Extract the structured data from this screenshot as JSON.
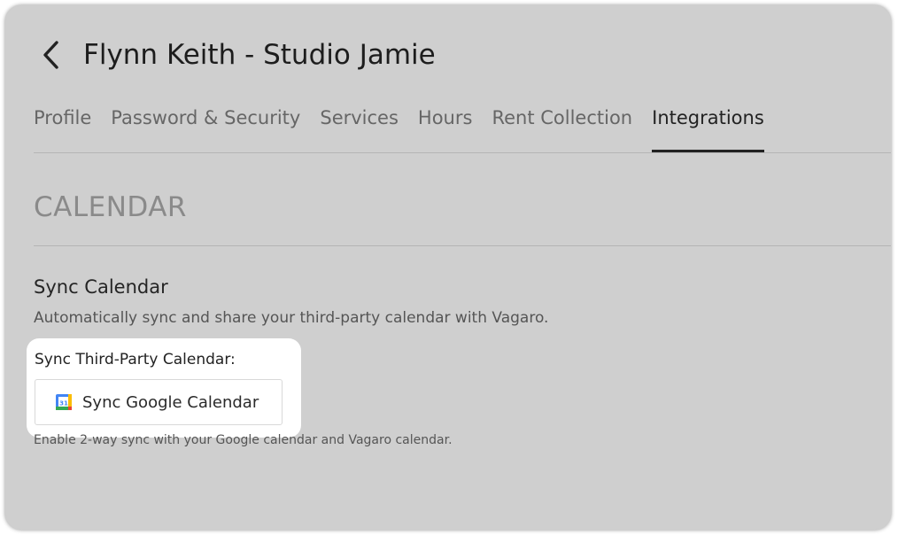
{
  "header": {
    "title": "Flynn Keith - Studio Jamie",
    "back_icon": "chevron-left-icon"
  },
  "tabs": [
    {
      "label": "Profile",
      "active": false
    },
    {
      "label": "Password & Security",
      "active": false
    },
    {
      "label": "Services",
      "active": false
    },
    {
      "label": "Hours",
      "active": false
    },
    {
      "label": "Rent Collection",
      "active": false
    },
    {
      "label": "Integrations",
      "active": true
    }
  ],
  "section": {
    "title": "CALENDAR"
  },
  "sync": {
    "heading": "Sync Calendar",
    "description": "Automatically sync and share your third-party calendar with Vagaro.",
    "third_party_label": "Sync Third-Party Calendar:",
    "button_label": "Sync Google Calendar",
    "button_icon": "google-calendar-icon",
    "icon_number": "31",
    "helper_text": "Enable 2-way sync with your Google calendar and Vagaro calendar."
  },
  "colors": {
    "background": "#cfcfcf",
    "highlight": "#ffffff",
    "active_tab": "#222222",
    "section_title": "#8a8a8a"
  }
}
